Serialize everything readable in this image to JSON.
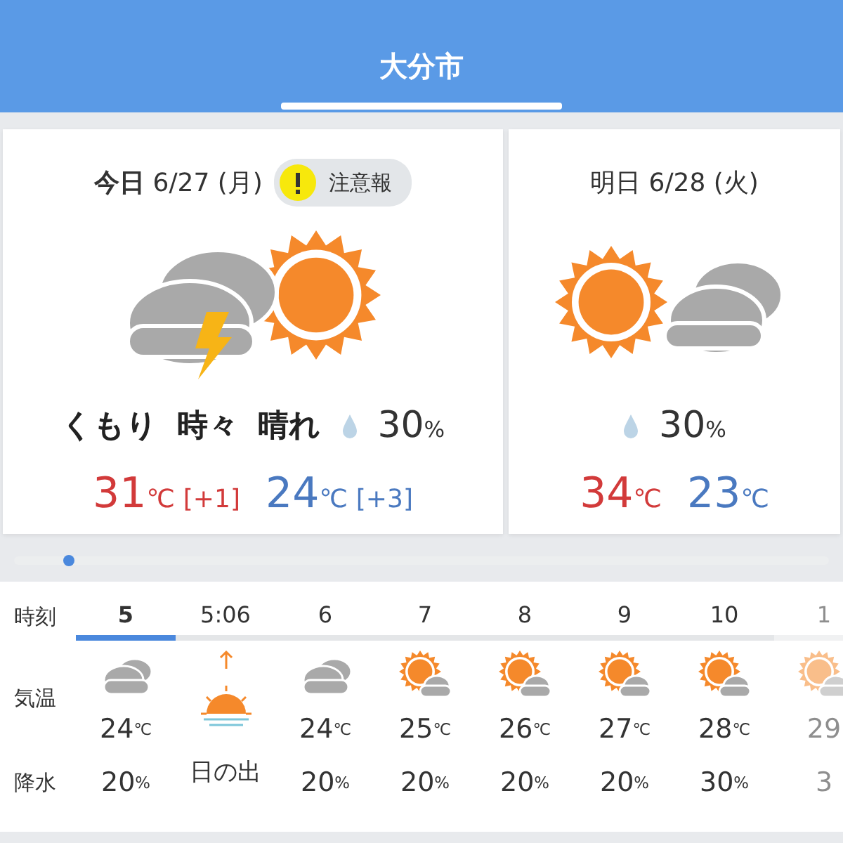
{
  "header": {
    "title": "大分市"
  },
  "days": [
    {
      "label": "今日",
      "date": "6/27 (月)",
      "warning": {
        "text": "注意報"
      },
      "kind": "cloud_thunder_sun",
      "weather": "くもり 時々 晴れ",
      "rain": {
        "value": "30",
        "unit": "%"
      },
      "high": {
        "value": "31",
        "unit": "℃",
        "diff": "[+1]"
      },
      "low": {
        "value": "24",
        "unit": "℃",
        "diff": "[+3]"
      }
    },
    {
      "label": "明日",
      "date": "6/28 (火)",
      "kind": "sun_cloud",
      "rain": {
        "value": "30",
        "unit": "%"
      },
      "high": {
        "value": "34",
        "unit": "℃"
      },
      "low": {
        "value": "23",
        "unit": "℃"
      }
    }
  ],
  "hourly": {
    "row_labels": [
      "時刻",
      "気温",
      "降水"
    ],
    "hours": [
      {
        "time": "5",
        "selected": true,
        "kind": "cloudy",
        "temp": {
          "value": "24",
          "unit": "℃"
        },
        "rain": {
          "value": "20",
          "unit": "%"
        }
      },
      {
        "time": "5:06",
        "selected": false,
        "kind": "sunrise",
        "event": "日の出"
      },
      {
        "time": "6",
        "selected": false,
        "kind": "cloudy",
        "temp": {
          "value": "24",
          "unit": "℃"
        },
        "rain": {
          "value": "20",
          "unit": "%"
        }
      },
      {
        "time": "7",
        "selected": false,
        "kind": "sun_cloud",
        "temp": {
          "value": "25",
          "unit": "℃"
        },
        "rain": {
          "value": "20",
          "unit": "%"
        }
      },
      {
        "time": "8",
        "selected": false,
        "kind": "sun_cloud",
        "temp": {
          "value": "26",
          "unit": "℃"
        },
        "rain": {
          "value": "20",
          "unit": "%"
        }
      },
      {
        "time": "9",
        "selected": false,
        "kind": "sun_cloud",
        "temp": {
          "value": "27",
          "unit": "℃"
        },
        "rain": {
          "value": "20",
          "unit": "%"
        }
      },
      {
        "time": "10",
        "selected": false,
        "kind": "sun_cloud",
        "temp": {
          "value": "28",
          "unit": "℃"
        },
        "rain": {
          "value": "30",
          "unit": "%"
        }
      },
      {
        "time": "1",
        "selected": false,
        "faded": true,
        "kind": "sun_cloud",
        "temp": {
          "value": "29"
        },
        "rain": {
          "value": "3"
        }
      }
    ]
  }
}
